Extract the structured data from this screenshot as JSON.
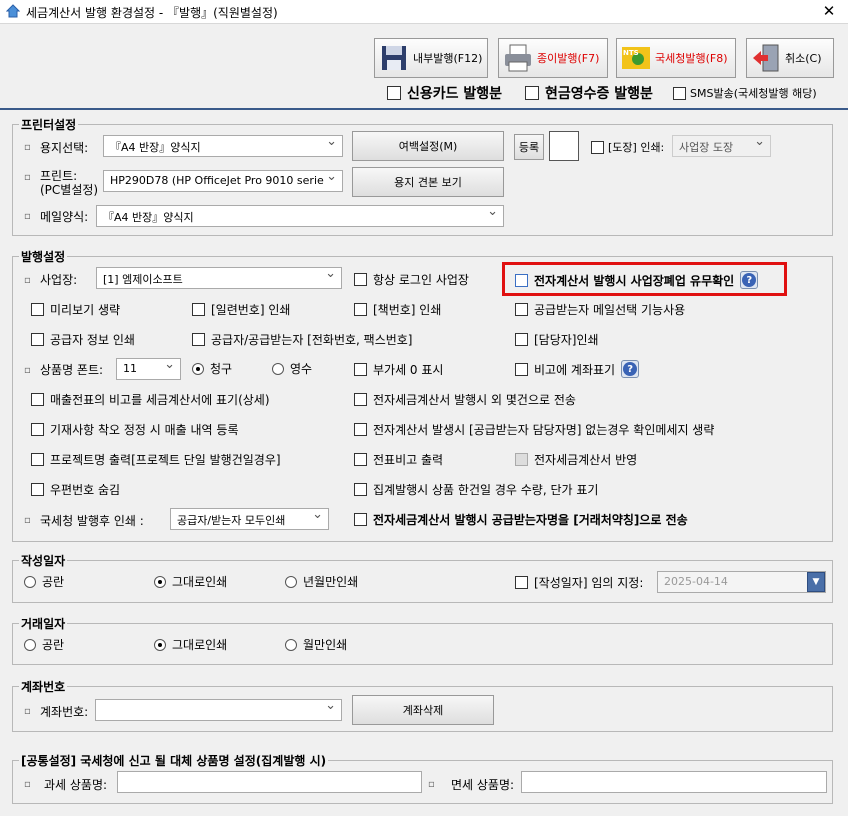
{
  "window": {
    "title": "세금계산서 발행 환경설정 - 『발행』(직원별설정)",
    "close": "✕"
  },
  "toolbar": {
    "internal": "내부발행(F12)",
    "paper": "종이발행(F7)",
    "nts": "국세청발행(F8)",
    "cancel": "취소(C)",
    "credit_card": "신용카드 발행분",
    "cash_receipt": "현금영수증 발행분",
    "sms": "SMS발송(국세청발행 해당)"
  },
  "printer": {
    "title": "프린터설정",
    "paper_label": "용지선택:",
    "paper_value": "『A4 반장』양식지",
    "margin_btn": "여백설정(M)",
    "register_btn": "등록",
    "stamp_label": "[도장] 인쇄:",
    "stamp_value": "사업장 도장",
    "printer_label": "프린트:",
    "printer_sub": "(PC별설정)",
    "printer_value": "HP290D78 (HP OfficeJet Pro 9010 serie",
    "sample_btn": "용지 견본 보기",
    "mail_label": "메일양식:",
    "mail_value": "『A4 반장』양식지"
  },
  "issue": {
    "title": "발행설정",
    "biz_label": "사업장:",
    "biz_value": "[1] 엠제이소프트",
    "always_login": "항상 로그인 사업장",
    "closure_check": "전자계산서 발행시 사업장폐업 유무확인",
    "preview": "미리보기 생략",
    "serial": "[일련번호] 인쇄",
    "book": "[책번호] 인쇄",
    "buyer_mail": "공급받는자 메일선택 기능사용",
    "supplier_info": "공급자 정보 인쇄",
    "supplier_buyer": "공급자/공급받는자 [전화번호, 팩스번호]",
    "manager": "[담당자]인쇄",
    "font_label": "상품명 폰트:",
    "font_value": "11",
    "claim": "청구",
    "receipt": "영수",
    "vat_zero": "부가세 0 표시",
    "account_note": "비고에 계좌표기",
    "sales_memo": "매출전표의 비고를 세금계산서에 표기(상세)",
    "send_extra": "전자세금계산서 발행시 외 몇건으로 전송",
    "correction": "기재사항 착오 정정 시 매출 내역 등록",
    "no_manager_msg": "전자계산서 발생시 [공급받는자 담당자명] 없는경우 확인메세지 생략",
    "project": "프로젝트명 출력[프로젝트 단일 발행건일경우]",
    "slip_memo": "전표비고 출력",
    "apply_einvoice": "전자세금계산서 반영",
    "hide_zip": "우편번호 숨김",
    "aggregate": "집계발행시 상품 한건일 경우 수량, 단가 표기",
    "nts_print_label": "국세청 발행후 인쇄 :",
    "nts_print_value": "공급자/받는자 모두인쇄",
    "trade_name": "전자세금계산서 발행시 공급받는자명을 [거래처약칭]으로 전송"
  },
  "write_date": {
    "title": "작성일자",
    "blank": "공란",
    "as_is": "그대로인쇄",
    "ym": "년월만인쇄",
    "custom": "[작성일자] 임의 지정:",
    "date": "2025-04-14"
  },
  "trade_date": {
    "title": "거래일자",
    "blank": "공란",
    "as_is": "그대로인쇄",
    "month": "월만인쇄"
  },
  "account": {
    "title": "계좌번호",
    "label": "계좌번호:",
    "delete_btn": "계좌삭제"
  },
  "common": {
    "title": "[공통설정] 국세청에 신고 될 대체 상품명 설정(집계발행 시)",
    "taxable": "과세 상품명:",
    "exempt": "면세 상품명:"
  }
}
